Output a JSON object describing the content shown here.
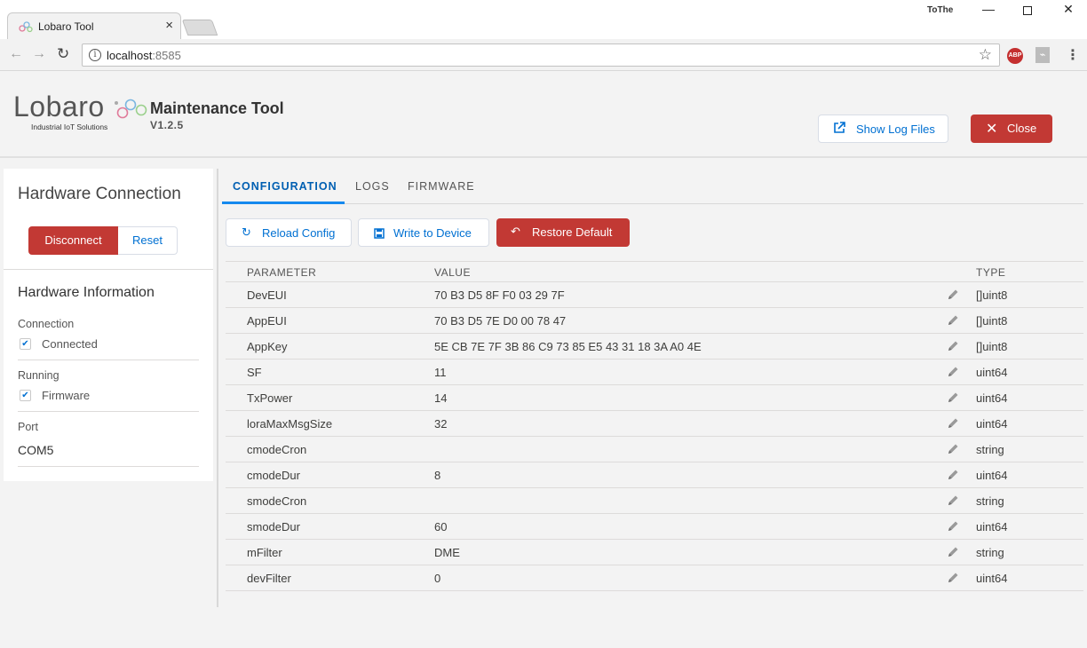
{
  "browser": {
    "tab_title": "Lobaro Tool",
    "tab_close": "×",
    "user_label": "ToThe",
    "url_host": "localhost",
    "url_port": ":8585",
    "info_glyph": "i",
    "abp_label": "ABP"
  },
  "header": {
    "logo_word": "Lobaro",
    "logo_tagline": "Industrial IoT Solutions",
    "title": "Maintenance Tool",
    "version": "V1.2.5",
    "log_files_label": "Show Log Files",
    "close_label": "Close"
  },
  "left": {
    "title": "Hardware Connection",
    "disconnect_label": "Disconnect",
    "reset_label": "Reset",
    "info_title": "Hardware Information",
    "connection_label": "Connection",
    "connected_label": "Connected",
    "connected_checked": true,
    "running_label": "Running",
    "firmware_label": "Firmware",
    "firmware_checked": true,
    "port_label": "Port",
    "port_value": "COM5"
  },
  "tabs": [
    {
      "label": "CONFIGURATION",
      "active": true
    },
    {
      "label": "LOGS",
      "active": false
    },
    {
      "label": "FIRMWARE",
      "active": false
    }
  ],
  "actions": {
    "reload_label": "Reload Config",
    "write_label": "Write to Device",
    "restore_label": "Restore Default"
  },
  "table": {
    "headers": {
      "parameter": "PARAMETER",
      "value": "VALUE",
      "type": "TYPE"
    },
    "rows": [
      {
        "parameter": "DevEUI",
        "value": "70 B3 D5 8F F0 03 29 7F",
        "type": "[]uint8"
      },
      {
        "parameter": "AppEUI",
        "value": "70 B3 D5 7E D0 00 78 47",
        "type": "[]uint8"
      },
      {
        "parameter": "AppKey",
        "value": "5E CB 7E 7F 3B 86 C9 73 85 E5 43 31 18 3A A0 4E",
        "type": "[]uint8"
      },
      {
        "parameter": "SF",
        "value": "11",
        "type": "uint64"
      },
      {
        "parameter": "TxPower",
        "value": "14",
        "type": "uint64"
      },
      {
        "parameter": "loraMaxMsgSize",
        "value": "32",
        "type": "uint64"
      },
      {
        "parameter": "cmodeCron",
        "value": "",
        "type": "string"
      },
      {
        "parameter": "cmodeDur",
        "value": "8",
        "type": "uint64"
      },
      {
        "parameter": "smodeCron",
        "value": "",
        "type": "string"
      },
      {
        "parameter": "smodeDur",
        "value": "60",
        "type": "uint64"
      },
      {
        "parameter": "mFilter",
        "value": "DME",
        "type": "string"
      },
      {
        "parameter": "devFilter",
        "value": "0",
        "type": "uint64"
      }
    ]
  },
  "colors": {
    "brand_red": "#c23934",
    "link_blue": "#0070d2",
    "tab_active_blue": "#1589ee"
  }
}
